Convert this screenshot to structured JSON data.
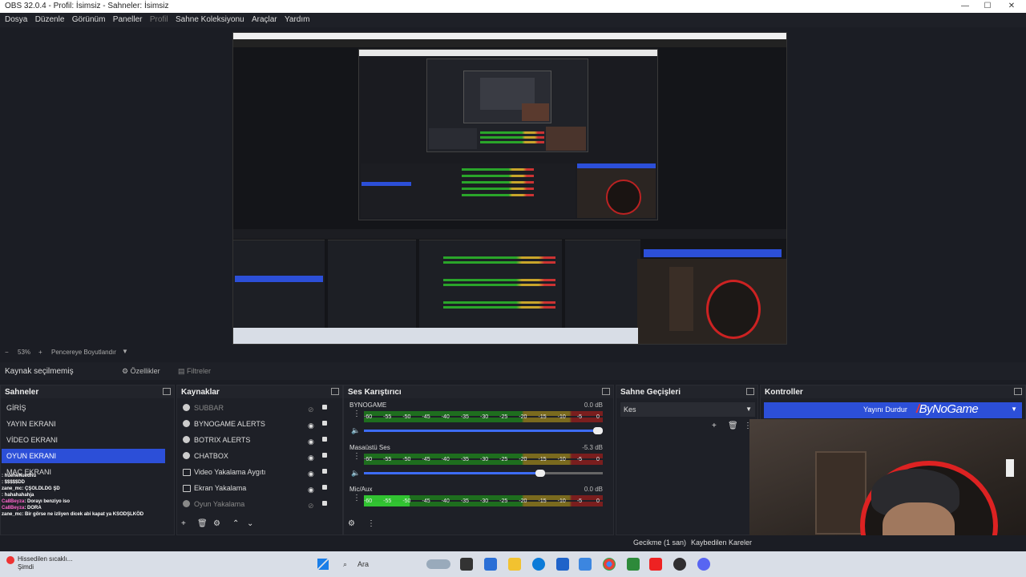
{
  "window": {
    "title": "OBS 32.0.4 - Profil: İsimsiz - Sahneler: İsimsiz"
  },
  "menu": {
    "items": [
      "Dosya",
      "Düzenle",
      "Görünüm",
      "Paneller",
      "Profil",
      "Sahne Koleksiyonu",
      "Araçlar",
      "Yardım"
    ]
  },
  "preview": {
    "zoom": "53%",
    "zoom_plus": "+",
    "zoom_minus": "−",
    "fit_label": "Pencereye Boyutlandır"
  },
  "source_bar": {
    "label": "Kaynak seçilmemiş",
    "properties": "Özellikler",
    "filters": "Filtreler"
  },
  "scenes": {
    "title": "Sahneler",
    "items": [
      {
        "label": "GİRİŞ"
      },
      {
        "label": "YAYIN EKRANI"
      },
      {
        "label": "VİDEO EKRANI"
      },
      {
        "label": "OYUN EKRANI"
      },
      {
        "label": "MAÇ EKRANI"
      }
    ],
    "selected_index": 3
  },
  "chat": {
    "lines": [
      {
        "user": "",
        "text": ": huehehuedhu"
      },
      {
        "user": "",
        "text": ": $$$$$DD"
      },
      {
        "user": "zane_mc",
        "text": ": ÇŞOLDLDG ŞD"
      },
      {
        "user": "",
        "text": ": hahahahahja"
      },
      {
        "user": "Ca8Beyza",
        "text": ": Dorayı benziyo iso"
      },
      {
        "user": "Ca8Beyza",
        "text": ": DORA"
      },
      {
        "user": "zane_mc",
        "text": ": Bir görse ne izliyen dicek abi kapat ya KSODŞLKÖD"
      }
    ]
  },
  "sources": {
    "title": "Kaynaklar",
    "items": [
      {
        "label": "SUBBAR",
        "visible": false
      },
      {
        "label": "BYNOGAME ALERTS",
        "visible": true
      },
      {
        "label": "BOTRIX ALERTS",
        "visible": true
      },
      {
        "label": "CHATBOX",
        "visible": true
      },
      {
        "label": "Video Yakalama Aygıtı",
        "visible": true
      },
      {
        "label": "Ekran Yakalama",
        "visible": true
      },
      {
        "label": "Oyun Yakalama",
        "visible": false
      }
    ]
  },
  "mixer": {
    "title": "Ses Karıştırıcı",
    "ticks": [
      "-60",
      "-55",
      "-50",
      "-45",
      "-40",
      "-35",
      "-30",
      "-25",
      "-20",
      "-15",
      "-10",
      "-5",
      "0"
    ],
    "channels": [
      {
        "name": "BYNOGAME",
        "db": "0.0 dB",
        "level": 0,
        "volume": 1.0
      },
      {
        "name": "Masaüstü Ses",
        "db": "-5.3 dB",
        "level": 0,
        "volume": 0.76
      },
      {
        "name": "Mic/Aux",
        "db": "0.0 dB",
        "level": 0.19,
        "volume": 1.0
      }
    ]
  },
  "transitions": {
    "title": "Sahne Geçişleri",
    "selected": "Kes"
  },
  "controls": {
    "title": "Kontroller",
    "stop_stream": "Yayını Durdur",
    "logo_text": "ByNoGame"
  },
  "status": {
    "delay": "Gecikme (1 san)",
    "dropped": "Kaybedilen Kareler"
  },
  "taskbar": {
    "weather_title": "Hissedilen sıcaklı...",
    "weather_sub": "Şimdi",
    "search": "Ara"
  },
  "colors": {
    "accent": "#2c4fd8",
    "live": "#e33333"
  }
}
